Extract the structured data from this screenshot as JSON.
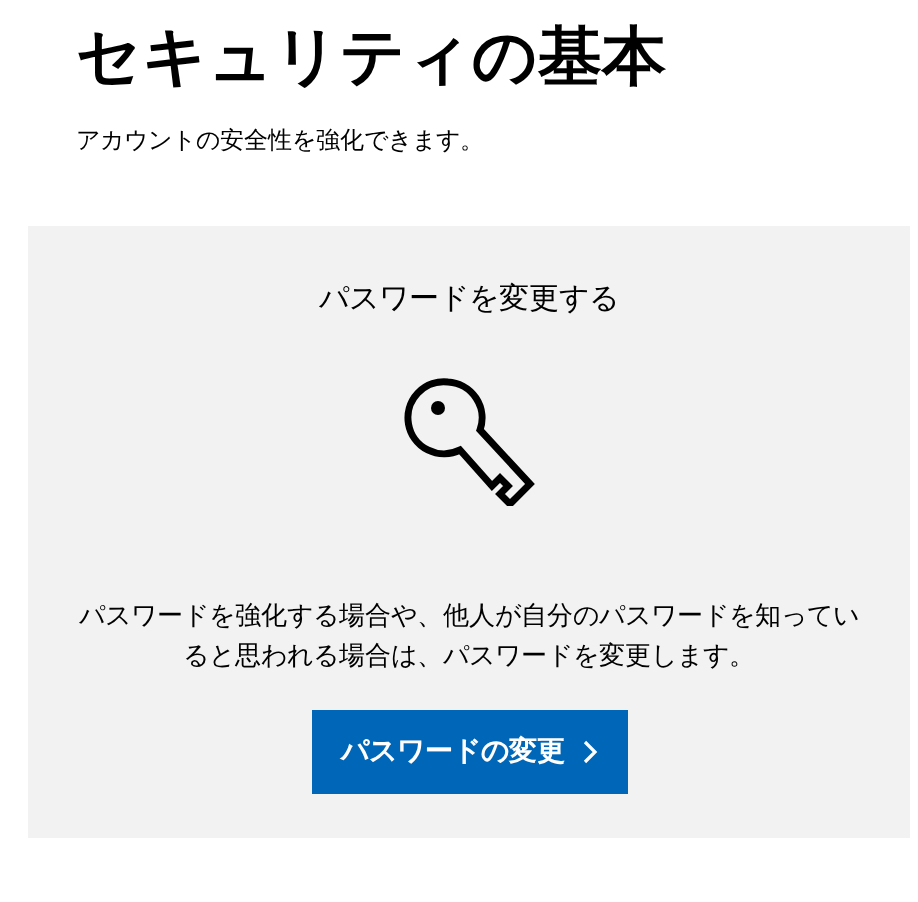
{
  "title": "セキュリティの基本",
  "subtitle": "アカウントの安全性を強化できます。",
  "card": {
    "heading": "パスワードを変更する",
    "description": "パスワードを強化する場合や、他人が自分のパスワードを知っていると思われる場合は、パスワードを変更します。",
    "button": "パスワードの変更"
  }
}
